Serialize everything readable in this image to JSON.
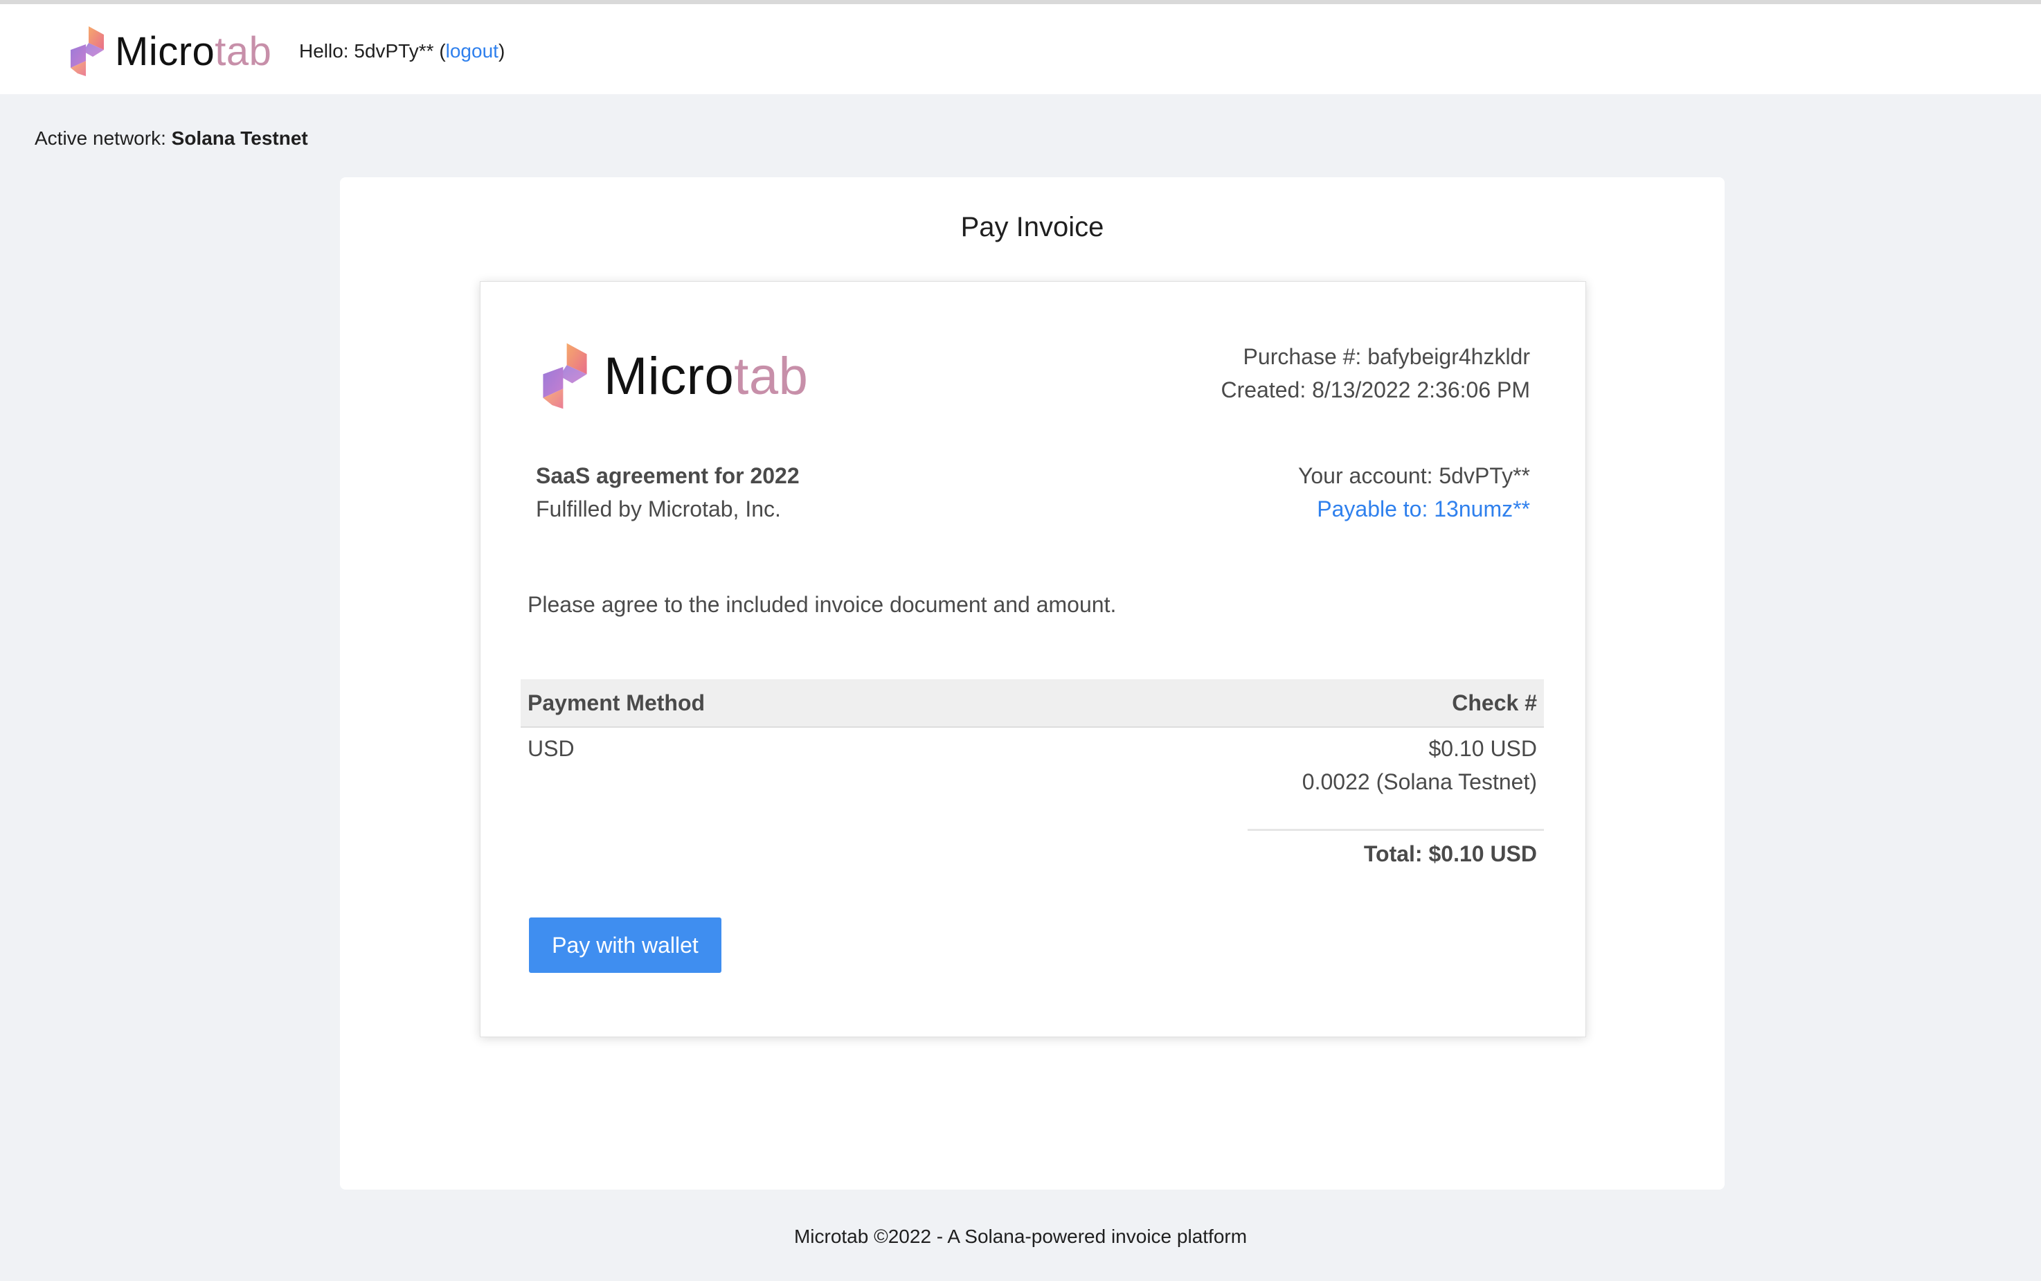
{
  "header": {
    "brand_micro": "Micro",
    "brand_tab": "tab",
    "hello_prefix": "Hello: 5dvPTy** (",
    "logout_label": "logout",
    "hello_suffix": ")"
  },
  "network": {
    "label": "Active network: ",
    "value": "Solana Testnet"
  },
  "panel": {
    "title": "Pay Invoice"
  },
  "invoice": {
    "brand_micro": "Micro",
    "brand_tab": "tab",
    "purchase": "Purchase #: bafybeigr4hzkldr",
    "created": "Created: 8/13/2022 2:36:06 PM",
    "agreement_title": "SaaS agreement for 2022",
    "fulfilled_by": "Fulfilled by Microtab, Inc.",
    "your_account": "Your account: 5dvPTy**",
    "payable_to": "Payable to: 13numz**",
    "note": "Please agree to the included invoice document and amount.",
    "table": {
      "col_left": "Payment Method",
      "col_right": "Check #",
      "method": "USD",
      "amount_usd": "$0.10 USD",
      "amount_crypto": "0.0022 (Solana Testnet)",
      "total": "Total: $0.10 USD"
    },
    "pay_button": "Pay with wallet"
  },
  "footer": {
    "text": "Microtab ©2022 - A Solana-powered invoice platform"
  },
  "colors": {
    "accent": "#3f8ef0",
    "link": "#2f80ed",
    "brand_tab": "#c78fa9",
    "background": "#f0f2f5"
  },
  "icons": {
    "logo": "microtab-logo-icon"
  }
}
